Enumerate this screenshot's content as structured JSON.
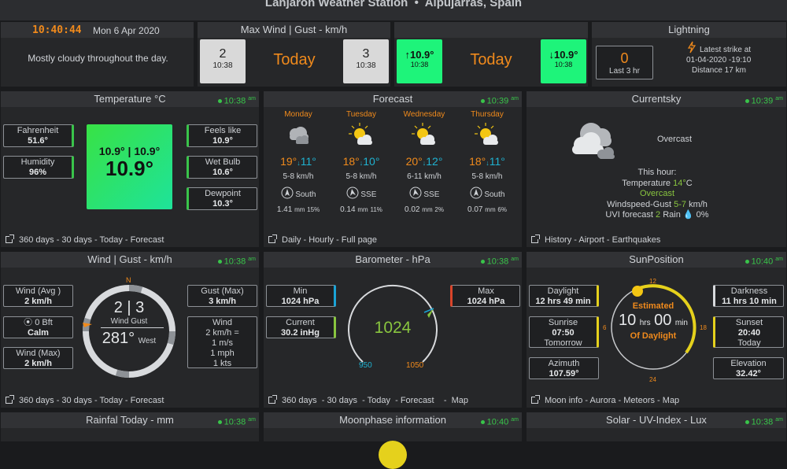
{
  "header": {
    "title": "Lanjaron Weather Station  •  Alpujarras, Spain"
  },
  "clock": {
    "time": "10:40:44",
    "date": "Mon 6 Apr 2020",
    "forecast_text": "Mostly cloudy throughout the day."
  },
  "maxwind": {
    "title": "Max Wind | Gust - km/h",
    "wind_value": "2",
    "wind_time": "10:38",
    "label": "Today",
    "gust_value": "3",
    "gust_time": "10:38"
  },
  "temp_extremes": {
    "high_value": "↑10.9°",
    "high_time": "10:38",
    "label": "Today",
    "low_value": "↓10.9°",
    "low_time": "10:38"
  },
  "lightning": {
    "title": "Lightning",
    "count": "0",
    "count_label": "Last 3 hr",
    "latest_label": "Latest strike at",
    "latest_time": "01-04-2020 -19:10",
    "distance": "Distance 17 km"
  },
  "temperature": {
    "title": "Temperature °C",
    "updated": "10:38",
    "ampm": "am",
    "fahrenheit_label": "Fahrenheit",
    "fahrenheit_value": "51.6°",
    "humidity_label": "Humidity",
    "humidity_value": "96%",
    "hilo": "10.9° | 10.9°",
    "current": "10.9°",
    "feels_label": "Feels like",
    "feels_value": "10.9°",
    "wetbulb_label": "Wet Bulb",
    "wetbulb_value": "10.6°",
    "dew_label": "Dewpoint",
    "dew_value": "10.3°",
    "footer": "360 days  - 30 days  - Today  - Forecast"
  },
  "forecast": {
    "title": "Forecast",
    "updated": "10:39",
    "ampm": "am",
    "days": [
      {
        "day": "Monday",
        "hi": "19°",
        "lo": "11°",
        "wind": "5-8 km/h",
        "dir": "South",
        "rain": "1.41",
        "unit": "mm",
        "pct": "15%"
      },
      {
        "day": "Tuesday",
        "hi": "18°",
        "lo": "10°",
        "wind": "5-8 km/h",
        "dir": "SSE",
        "rain": "0.14",
        "unit": "mm",
        "pct": "11%"
      },
      {
        "day": "Wednesday",
        "hi": "20°",
        "lo": "12°",
        "wind": "6-11 km/h",
        "dir": "SSE",
        "rain": "0.02",
        "unit": "mm",
        "pct": "2%"
      },
      {
        "day": "Thursday",
        "hi": "18°",
        "lo": "11°",
        "wind": "5-8 km/h",
        "dir": "South",
        "rain": "0.07",
        "unit": "mm",
        "pct": "6%"
      }
    ],
    "footer": "Daily  - Hourly  - Full page"
  },
  "currentsky": {
    "title": "Currentsky",
    "updated": "10:39",
    "ampm": "am",
    "condition": "Overcast",
    "this_hour": "This hour:",
    "temp_label": "Temperature",
    "temp_value": "14°",
    "temp_unit": "C",
    "condition2": "Overcast",
    "wind_label": "Windspeed-Gust",
    "wind_value": "5-7",
    "wind_unit": "km/h",
    "uvi_label": "UVI forecast",
    "uvi_value": "2",
    "rain_label": "Rain",
    "rain_value": "0%",
    "footer": "History  - Airport  - Earthquakes"
  },
  "wind": {
    "title": "Wind | Gust - km/h",
    "updated": "10:38",
    "ampm": "am",
    "avg_label": "Wind (Avg )",
    "avg_value": "2 km/h",
    "bft_label": "0 Bft",
    "bft_value": "Calm",
    "max_label": "Wind (Max)",
    "max_value": "2 km/h",
    "north": "N",
    "speed": "2 | 3",
    "wind_lbl": "Wind",
    "gust_lbl": "Gust",
    "bearing": "281°",
    "bearing_dir": "West",
    "gust_max_label": "Gust (Max)",
    "gust_max_value": "3 km/h",
    "conv_label": "Wind",
    "conv_1": "2 km/h =",
    "conv_2": "1 m/s",
    "conv_3": "1 mph",
    "conv_4": "1 kts",
    "footer": "360 days  - 30 days  - Today  - Forecast"
  },
  "barometer": {
    "title": "Barometer - hPa",
    "updated": "10:38",
    "ampm": "am",
    "min_label": "Min",
    "min_value": "1024 hPa",
    "current_label": "Current",
    "current_value": "30.2 inHg",
    "max_label": "Max",
    "max_value": "1024 hPa",
    "reading": "1024",
    "scale_min": "950",
    "scale_max": "1050",
    "footer": "360 days  - 30 days  - Today  - Forecast    -  Map"
  },
  "sun": {
    "title": "SunPosition",
    "updated": "10:40",
    "ampm": "am",
    "daylight_label": "Daylight",
    "daylight_value": "12 hrs 49 min",
    "sunrise_label": "Sunrise",
    "sunrise_value": "07:50",
    "sunrise_sub": "Tomorrow",
    "azimuth_label": "Azimuth",
    "azimuth_value": "107.59°",
    "darkness_label": "Darkness",
    "darkness_value": "11 hrs 10 min",
    "sunset_label": "Sunset",
    "sunset_value": "20:40",
    "sunset_sub": "Today",
    "elevation_label": "Elevation",
    "elevation_value": "32.42°",
    "h12": "12",
    "h6": "6",
    "h18": "18",
    "h24": "24",
    "estimated": "Estimated",
    "hrs": "10",
    "hrs_unit": "hrs",
    "min": "00",
    "min_unit": "min",
    "of_daylight": "Of Daylight",
    "footer": "Moon info  - Aurora  - Meteors  - Map"
  },
  "bottom": {
    "rain_title": "Rainfal Today - mm",
    "rain_updated": "10:38",
    "rain_ampm": "am",
    "moon_title": "Moonphase information",
    "moon_updated": "10:40",
    "moon_ampm": "am",
    "solar_title": "Solar - UV-Index - Lux",
    "solar_updated": "10:38",
    "solar_ampm": "am"
  },
  "colors": {
    "accent_orange": "#f08a1c",
    "green": "#39c44a",
    "cyan": "#1fb2d1",
    "yellow": "#e5d11c"
  }
}
